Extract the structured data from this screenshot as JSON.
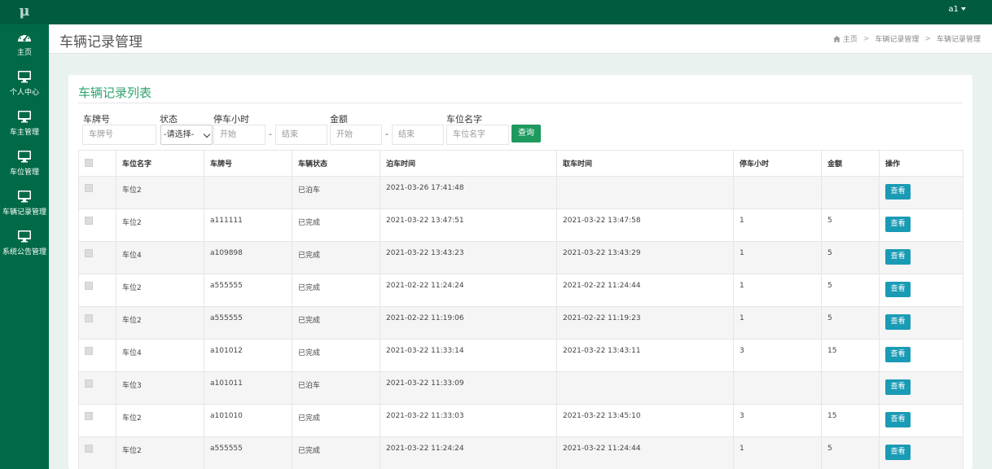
{
  "app": {
    "logo": "μ",
    "user": "a1"
  },
  "sidebar": {
    "items": [
      {
        "label": "主页",
        "icon": "dashboard-icon"
      },
      {
        "label": "个人中心",
        "icon": "monitor-icon"
      },
      {
        "label": "车主管理",
        "icon": "monitor-icon"
      },
      {
        "label": "车位管理",
        "icon": "monitor-icon"
      },
      {
        "label": "车辆记录管理",
        "icon": "monitor-icon"
      },
      {
        "label": "系统公告管理",
        "icon": "monitor-icon"
      }
    ]
  },
  "header": {
    "title": "车辆记录管理",
    "breadcrumb": [
      "主页",
      "车辆记录管理",
      "车辆记录管理"
    ]
  },
  "list": {
    "title": "车辆记录列表",
    "filters": {
      "plate_label": "车牌号",
      "plate_placeholder": "车牌号",
      "status_label": "状态",
      "status_value": "-请选择-",
      "hours_label": "停车小时",
      "hours_start_placeholder": "开始",
      "hours_end_placeholder": "结束",
      "amount_label": "金额",
      "amount_start_placeholder": "开始",
      "amount_end_placeholder": "结束",
      "dash": "-",
      "spot_label": "车位名字",
      "spot_placeholder": "车位名字",
      "search_label": "查询"
    },
    "columns": [
      "车位名字",
      "车牌号",
      "车辆状态",
      "泊车时间",
      "取车时间",
      "停车小时",
      "金额",
      "操作"
    ],
    "action_label": "查看",
    "rows": [
      [
        "车位2",
        "",
        "已泊车",
        "2021-03-26 17:41:48",
        "",
        "",
        ""
      ],
      [
        "车位2",
        "a111111",
        "已完成",
        "2021-03-22 13:47:51",
        "2021-03-22 13:47:58",
        "1",
        "5"
      ],
      [
        "车位4",
        "a109898",
        "已完成",
        "2021-03-22 13:43:23",
        "2021-03-22 13:43:29",
        "1",
        "5"
      ],
      [
        "车位2",
        "a555555",
        "已完成",
        "2021-02-22 11:24:24",
        "2021-02-22 11:24:44",
        "1",
        "5"
      ],
      [
        "车位2",
        "a555555",
        "已完成",
        "2021-02-22 11:19:06",
        "2021-02-22 11:19:23",
        "1",
        "5"
      ],
      [
        "车位4",
        "a101012",
        "已完成",
        "2021-03-22 11:33:14",
        "2021-03-22 13:43:11",
        "3",
        "15"
      ],
      [
        "车位3",
        "a101011",
        "已泊车",
        "2021-03-22 11:33:09",
        "",
        "",
        ""
      ],
      [
        "车位2",
        "a101010",
        "已完成",
        "2021-03-22 11:33:03",
        "2021-03-22 13:45:10",
        "3",
        "15"
      ],
      [
        "车位2",
        "a555555",
        "已完成",
        "2021-03-22 11:24:24",
        "2021-03-22 11:24:44",
        "1",
        "5"
      ]
    ]
  },
  "colors": {
    "topbar": "#005b40",
    "sidebar": "#006a48",
    "title_green": "#2ea36e",
    "search_btn": "#1e9a5e",
    "view_btn": "#1a9bb5"
  }
}
